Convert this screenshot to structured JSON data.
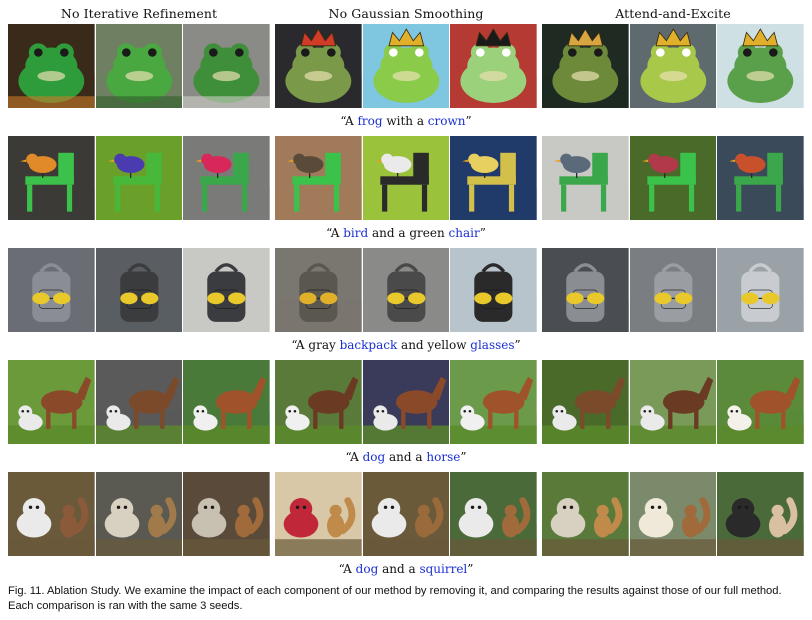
{
  "columns": [
    "No Iterative Refinement",
    "No Gaussian Smoothing",
    "Attend-and-Excite"
  ],
  "rows": [
    {
      "caption": [
        {
          "t": "“A "
        },
        {
          "t": "frog",
          "hl": true
        },
        {
          "t": " with a "
        },
        {
          "t": "crown",
          "hl": true
        },
        {
          "t": "”"
        }
      ],
      "tiles": [
        {
          "icon": "frog-photo",
          "bg": "#3a2a1a",
          "fg": "#2e9c3a",
          "accent": "#c97d2a"
        },
        {
          "icon": "frog-photo",
          "bg": "#6f7f62",
          "fg": "#4aa840",
          "accent": "#2e5e2a"
        },
        {
          "icon": "frog-photo",
          "bg": "#8a8a86",
          "fg": "#3e8e3a",
          "accent": "#cfd0c8"
        },
        {
          "icon": "frog-crown-photo",
          "bg": "#2a2a2e",
          "fg": "#7a9a4a",
          "accent": "#d23b25"
        },
        {
          "icon": "frog-crown-cartoon",
          "bg": "#7fc6e0",
          "fg": "#8acb4a",
          "accent": "#e0b02a"
        },
        {
          "icon": "frog-crown-cartoon",
          "bg": "#b53a33",
          "fg": "#9ad17a",
          "accent": "#1a1a1a"
        },
        {
          "icon": "frog-crown-photo",
          "bg": "#1e2a22",
          "fg": "#6c8a3a",
          "accent": "#d8a640"
        },
        {
          "icon": "frog-crown-cartoon",
          "bg": "#5e6a6e",
          "fg": "#a8c84a",
          "accent": "#e0b02a"
        },
        {
          "icon": "frog-crown-photo",
          "bg": "#cfe0e4",
          "fg": "#5aa04a",
          "accent": "#e0b02a"
        }
      ]
    },
    {
      "caption": [
        {
          "t": "“A "
        },
        {
          "t": "bird",
          "hl": true
        },
        {
          "t": " and a green "
        },
        {
          "t": "chair",
          "hl": true
        },
        {
          "t": "”"
        }
      ],
      "tiles": [
        {
          "icon": "bird-chair",
          "bg": "#3c3a36",
          "fg": "#3cc24a",
          "accent": "#e08a2a"
        },
        {
          "icon": "bird-chair",
          "bg": "#6aa02a",
          "fg": "#48b83a",
          "accent": "#4a3cb0"
        },
        {
          "icon": "bird-chair",
          "bg": "#7a7a78",
          "fg": "#3aa84a",
          "accent": "#d8285a"
        },
        {
          "icon": "bird-chair",
          "bg": "#a07a5a",
          "fg": "#3ac24a",
          "accent": "#5a4a3a"
        },
        {
          "icon": "bird-chair",
          "bg": "#9ac23a",
          "fg": "#2a2a2a",
          "accent": "#eaeaea"
        },
        {
          "icon": "bird-chair",
          "bg": "#203a6a",
          "fg": "#d2c04a",
          "accent": "#e8d060"
        },
        {
          "icon": "bird-chair",
          "bg": "#c8c8c4",
          "fg": "#3aa84a",
          "accent": "#5a6a7a"
        },
        {
          "icon": "bird-chair",
          "bg": "#4a6a2a",
          "fg": "#3ac24a",
          "accent": "#b03a4a"
        },
        {
          "icon": "bird-chair",
          "bg": "#3a4a5a",
          "fg": "#3aa84a",
          "accent": "#c8502a"
        }
      ]
    },
    {
      "caption": [
        {
          "t": "“A gray "
        },
        {
          "t": "backpack",
          "hl": true
        },
        {
          "t": " and yellow "
        },
        {
          "t": "glasses",
          "hl": true
        },
        {
          "t": "”"
        }
      ],
      "tiles": [
        {
          "icon": "backpack-glasses",
          "bg": "#6a6e74",
          "fg": "#8a8e94",
          "accent": "#e8c82a"
        },
        {
          "icon": "backpack-glasses",
          "bg": "#5a5e62",
          "fg": "#3a3c3e",
          "accent": "#e8c82a"
        },
        {
          "icon": "backpack-glasses",
          "bg": "#c8c8c4",
          "fg": "#3a3c40",
          "accent": "#e8c82a"
        },
        {
          "icon": "backpack-glasses",
          "bg": "#7a7670",
          "fg": "#5a5650",
          "accent": "#e0b02a"
        },
        {
          "icon": "backpack-glasses",
          "bg": "#8a8a88",
          "fg": "#4a4a4a",
          "accent": "#e8c82a"
        },
        {
          "icon": "backpack-glasses",
          "bg": "#b8c4cc",
          "fg": "#2a2a2a",
          "accent": "#e8c82a"
        },
        {
          "icon": "backpack-glasses",
          "bg": "#4a4e52",
          "fg": "#8a8e92",
          "accent": "#e8c82a"
        },
        {
          "icon": "backpack-glasses",
          "bg": "#7a7e82",
          "fg": "#9a9ea2",
          "accent": "#e8c82a"
        },
        {
          "icon": "backpack-glasses",
          "bg": "#9aa2a8",
          "fg": "#c8ccd0",
          "accent": "#e8c82a"
        }
      ]
    },
    {
      "caption": [
        {
          "t": "“A "
        },
        {
          "t": "dog",
          "hl": true
        },
        {
          "t": " and a "
        },
        {
          "t": "horse",
          "hl": true
        },
        {
          "t": "”"
        }
      ],
      "tiles": [
        {
          "icon": "dog-horse",
          "bg": "#6a9a3a",
          "fg": "#8a4a2a",
          "accent": "#eaeaea"
        },
        {
          "icon": "dog-horse",
          "bg": "#5a5a5a",
          "fg": "#7a4a2a",
          "accent": "#eaeaea"
        },
        {
          "icon": "dog-horse",
          "bg": "#4a7a3a",
          "fg": "#a0522a",
          "accent": "#f0f0f0"
        },
        {
          "icon": "dog-horse",
          "bg": "#5a7a3a",
          "fg": "#6a3a22",
          "accent": "#f0f0f0"
        },
        {
          "icon": "dog-horse",
          "bg": "#3a3a5a",
          "fg": "#8a4a2a",
          "accent": "#eaeaea"
        },
        {
          "icon": "dog-horse",
          "bg": "#6a9a4a",
          "fg": "#a0522a",
          "accent": "#f0f0f0"
        },
        {
          "icon": "dog-horse",
          "bg": "#4a6a2a",
          "fg": "#7a4a2a",
          "accent": "#eaeaea"
        },
        {
          "icon": "dog-horse",
          "bg": "#7a9a5a",
          "fg": "#6a3a22",
          "accent": "#eaeaea"
        },
        {
          "icon": "dog-horse",
          "bg": "#5a8a3a",
          "fg": "#a0522a",
          "accent": "#f4f0ea"
        }
      ]
    },
    {
      "caption": [
        {
          "t": "“A "
        },
        {
          "t": "dog",
          "hl": true
        },
        {
          "t": " and a "
        },
        {
          "t": "squirrel",
          "hl": true
        },
        {
          "t": "”"
        }
      ],
      "tiles": [
        {
          "icon": "dog-squirrel",
          "bg": "#6a5a3a",
          "fg": "#8a5a3a",
          "accent": "#eaeaea"
        },
        {
          "icon": "dog-squirrel",
          "bg": "#5a5a52",
          "fg": "#a07a4a",
          "accent": "#d8d0c0"
        },
        {
          "icon": "dog-squirrel",
          "bg": "#5a4a3a",
          "fg": "#a06a3a",
          "accent": "#c8c0b0"
        },
        {
          "icon": "dog-squirrel",
          "bg": "#d8c8a8",
          "fg": "#c08a4a",
          "accent": "#c0283a"
        },
        {
          "icon": "dog-squirrel",
          "bg": "#6a5a3a",
          "fg": "#9a6a3a",
          "accent": "#eaeaea"
        },
        {
          "icon": "dog-squirrel",
          "bg": "#4a6a3a",
          "fg": "#a06a3a",
          "accent": "#eaeaea"
        },
        {
          "icon": "dog-squirrel",
          "bg": "#5a7a3a",
          "fg": "#c08a4a",
          "accent": "#d8d0c0"
        },
        {
          "icon": "dog-squirrel",
          "bg": "#7a8a6a",
          "fg": "#a06a3a",
          "accent": "#f0e8d8"
        },
        {
          "icon": "dog-squirrel",
          "bg": "#4a6a3a",
          "fg": "#d8c0a0",
          "accent": "#2a2a2a"
        }
      ]
    }
  ],
  "figure_caption_line1": "Fig. 11.  Ablation Study. We examine the impact of each component of our method by removing it, and comparing the results against those of our full method.",
  "figure_caption_line2": "Each comparison is ran with the same 3 seeds."
}
